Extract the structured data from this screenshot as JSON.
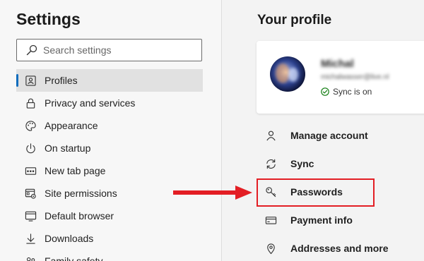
{
  "left_pane": {
    "title": "Settings",
    "search": {
      "placeholder": "Search settings",
      "icon": "search-icon"
    },
    "nav_items": [
      {
        "label": "Profiles",
        "icon": "profile-card-icon",
        "active": true
      },
      {
        "label": "Privacy and services",
        "icon": "lock-icon"
      },
      {
        "label": "Appearance",
        "icon": "palette-icon"
      },
      {
        "label": "On startup",
        "icon": "power-icon"
      },
      {
        "label": "New tab page",
        "icon": "new-tab-icon"
      },
      {
        "label": "Site permissions",
        "icon": "site-permissions-icon"
      },
      {
        "label": "Default browser",
        "icon": "browser-icon"
      },
      {
        "label": "Downloads",
        "icon": "download-icon"
      },
      {
        "label": "Family safety",
        "icon": "family-icon"
      }
    ]
  },
  "right_pane": {
    "title": "Your profile",
    "profile": {
      "name": "Michal",
      "email": "michalwasser@live.nl",
      "sync_status": "Sync is on"
    },
    "menu_items": [
      {
        "label": "Manage account",
        "icon": "person-icon"
      },
      {
        "label": "Sync",
        "icon": "sync-icon"
      },
      {
        "label": "Passwords",
        "icon": "key-icon",
        "highlighted": true
      },
      {
        "label": "Payment info",
        "icon": "card-icon"
      },
      {
        "label": "Addresses and more",
        "icon": "location-icon"
      }
    ]
  },
  "colors": {
    "accent": "#0f6cbd",
    "highlight": "#e31e24",
    "sync_ok": "#107c10"
  }
}
